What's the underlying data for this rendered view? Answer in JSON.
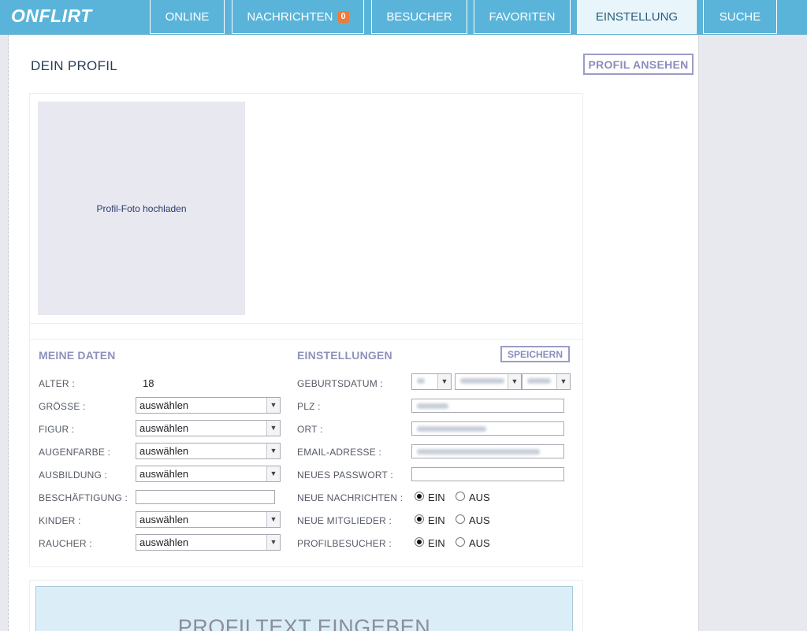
{
  "app": {
    "logo": "ONFLIRT"
  },
  "nav": {
    "online": "ONLINE",
    "nachrichten": "NACHRICHTEN",
    "nachrichten_badge": "0",
    "besucher": "BESUCHER",
    "favoriten": "FAVORITEN",
    "einstellung": "EINSTELLUNG",
    "suche": "SUCHE"
  },
  "page": {
    "title": "DEIN PROFIL",
    "view_profile_button": "PROFIL ANSEHEN"
  },
  "photo": {
    "upload_label": "Profil-Foto hochladen"
  },
  "meine_daten": {
    "title": "MEINE DATEN",
    "alter_label": "ALTER :",
    "alter_value": "18",
    "groesse_label": "GRÖSSE :",
    "groesse_value": "auswählen",
    "figur_label": "FIGUR :",
    "figur_value": "auswählen",
    "augenfarbe_label": "AUGENFARBE :",
    "augenfarbe_value": "auswählen",
    "ausbildung_label": "AUSBILDUNG :",
    "ausbildung_value": "auswählen",
    "beschaeftigung_label": "BESCHÄFTIGUNG :",
    "beschaeftigung_value": "",
    "kinder_label": "KINDER :",
    "kinder_value": "auswählen",
    "raucher_label": "RAUCHER :",
    "raucher_value": "auswählen"
  },
  "einstellungen": {
    "title": "EINSTELLUNGEN",
    "save_button": "SPEICHERN",
    "geburtsdatum_label": "GEBURTSDATUM :",
    "plz_label": "PLZ :",
    "ort_label": "ORT :",
    "email_label": "EMAIL-ADRESSE :",
    "passwort_label": "NEUES PASSWORT :",
    "neue_nachrichten_label": "NEUE NACHRICHTEN :",
    "neue_mitglieder_label": "NEUE MITGLIEDER :",
    "profilbesucher_label": "PROFILBESUCHER :",
    "ein": "EIN",
    "aus": "AUS"
  },
  "profiltext": {
    "placeholder": "PROFILTEXT EINGEBEN"
  },
  "colors": {
    "accent": "#5ab4d9",
    "badge": "#f07a3a",
    "section_title": "#8f91bd"
  }
}
